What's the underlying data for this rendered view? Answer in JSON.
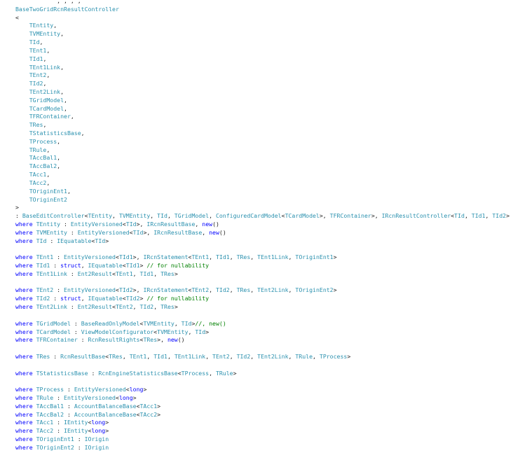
{
  "theme": {
    "keyword": "#0000ff",
    "type": "#2b91af",
    "plain": "#1e1e1e",
    "comment": "#008000",
    "background": "#ffffff"
  },
  "lines": [
    [
      [
        "plain",
        "            , , , ,"
      ]
    ],
    [
      [
        "type",
        "BaseTwoGridRcnResultController"
      ]
    ],
    [
      [
        "plain",
        "<"
      ]
    ],
    [
      [
        "plain",
        "    "
      ],
      [
        "type",
        "TEntity"
      ],
      [
        "plain",
        ","
      ]
    ],
    [
      [
        "plain",
        "    "
      ],
      [
        "type",
        "TVMEntity"
      ],
      [
        "plain",
        ","
      ]
    ],
    [
      [
        "plain",
        "    "
      ],
      [
        "type",
        "TId"
      ],
      [
        "plain",
        ","
      ]
    ],
    [
      [
        "plain",
        "    "
      ],
      [
        "type",
        "TEnt1"
      ],
      [
        "plain",
        ","
      ]
    ],
    [
      [
        "plain",
        "    "
      ],
      [
        "type",
        "TId1"
      ],
      [
        "plain",
        ","
      ]
    ],
    [
      [
        "plain",
        "    "
      ],
      [
        "type",
        "TEnt1Link"
      ],
      [
        "plain",
        ","
      ]
    ],
    [
      [
        "plain",
        "    "
      ],
      [
        "type",
        "TEnt2"
      ],
      [
        "plain",
        ","
      ]
    ],
    [
      [
        "plain",
        "    "
      ],
      [
        "type",
        "TId2"
      ],
      [
        "plain",
        ","
      ]
    ],
    [
      [
        "plain",
        "    "
      ],
      [
        "type",
        "TEnt2Link"
      ],
      [
        "plain",
        ","
      ]
    ],
    [
      [
        "plain",
        "    "
      ],
      [
        "type",
        "TGridModel"
      ],
      [
        "plain",
        ","
      ]
    ],
    [
      [
        "plain",
        "    "
      ],
      [
        "type",
        "TCardModel"
      ],
      [
        "plain",
        ","
      ]
    ],
    [
      [
        "plain",
        "    "
      ],
      [
        "type",
        "TFRContainer"
      ],
      [
        "plain",
        ","
      ]
    ],
    [
      [
        "plain",
        "    "
      ],
      [
        "type",
        "TRes"
      ],
      [
        "plain",
        ","
      ]
    ],
    [
      [
        "plain",
        "    "
      ],
      [
        "type",
        "TStatisticsBase"
      ],
      [
        "plain",
        ","
      ]
    ],
    [
      [
        "plain",
        "    "
      ],
      [
        "type",
        "TProcess"
      ],
      [
        "plain",
        ","
      ]
    ],
    [
      [
        "plain",
        "    "
      ],
      [
        "type",
        "TRule"
      ],
      [
        "plain",
        ","
      ]
    ],
    [
      [
        "plain",
        "    "
      ],
      [
        "type",
        "TAccBal1"
      ],
      [
        "plain",
        ","
      ]
    ],
    [
      [
        "plain",
        "    "
      ],
      [
        "type",
        "TAccBal2"
      ],
      [
        "plain",
        ","
      ]
    ],
    [
      [
        "plain",
        "    "
      ],
      [
        "type",
        "TAcc1"
      ],
      [
        "plain",
        ","
      ]
    ],
    [
      [
        "plain",
        "    "
      ],
      [
        "type",
        "TAcc2"
      ],
      [
        "plain",
        ","
      ]
    ],
    [
      [
        "plain",
        "    "
      ],
      [
        "type",
        "TOriginEnt1"
      ],
      [
        "plain",
        ","
      ]
    ],
    [
      [
        "plain",
        "    "
      ],
      [
        "type",
        "TOriginEnt2"
      ]
    ],
    [
      [
        "plain",
        ">"
      ]
    ],
    [
      [
        "plain",
        ": "
      ],
      [
        "type",
        "BaseEditController"
      ],
      [
        "plain",
        "<"
      ],
      [
        "type",
        "TEntity"
      ],
      [
        "plain",
        ", "
      ],
      [
        "type",
        "TVMEntity"
      ],
      [
        "plain",
        ", "
      ],
      [
        "type",
        "TId"
      ],
      [
        "plain",
        ", "
      ],
      [
        "type",
        "TGridModel"
      ],
      [
        "plain",
        ", "
      ],
      [
        "type",
        "ConfiguredCardModel"
      ],
      [
        "plain",
        "<"
      ],
      [
        "type",
        "TCardModel"
      ],
      [
        "plain",
        ">, "
      ],
      [
        "type",
        "TFRContainer"
      ],
      [
        "plain",
        ">, "
      ],
      [
        "type",
        "IRcnResultController"
      ],
      [
        "plain",
        "<"
      ],
      [
        "type",
        "TId"
      ],
      [
        "plain",
        ", "
      ],
      [
        "type",
        "TId1"
      ],
      [
        "plain",
        ", "
      ],
      [
        "type",
        "TId2"
      ],
      [
        "plain",
        ">"
      ]
    ],
    [
      [
        "kw",
        "where"
      ],
      [
        "plain",
        " "
      ],
      [
        "type",
        "TEntity"
      ],
      [
        "plain",
        " : "
      ],
      [
        "type",
        "EntityVersioned"
      ],
      [
        "plain",
        "<"
      ],
      [
        "type",
        "TId"
      ],
      [
        "plain",
        ">, "
      ],
      [
        "type",
        "IRcnResultBase"
      ],
      [
        "plain",
        ", "
      ],
      [
        "kw",
        "new"
      ],
      [
        "plain",
        "()"
      ]
    ],
    [
      [
        "kw",
        "where"
      ],
      [
        "plain",
        " "
      ],
      [
        "type",
        "TVMEntity"
      ],
      [
        "plain",
        " : "
      ],
      [
        "type",
        "EntityVersioned"
      ],
      [
        "plain",
        "<"
      ],
      [
        "type",
        "TId"
      ],
      [
        "plain",
        ">, "
      ],
      [
        "type",
        "IRcnResultBase"
      ],
      [
        "plain",
        ", "
      ],
      [
        "kw",
        "new"
      ],
      [
        "plain",
        "()"
      ]
    ],
    [
      [
        "kw",
        "where"
      ],
      [
        "plain",
        " "
      ],
      [
        "type",
        "TId"
      ],
      [
        "plain",
        " : "
      ],
      [
        "type",
        "IEquatable"
      ],
      [
        "plain",
        "<"
      ],
      [
        "type",
        "TId"
      ],
      [
        "plain",
        ">"
      ]
    ],
    [],
    [
      [
        "kw",
        "where"
      ],
      [
        "plain",
        " "
      ],
      [
        "type",
        "TEnt1"
      ],
      [
        "plain",
        " : "
      ],
      [
        "type",
        "EntityVersioned"
      ],
      [
        "plain",
        "<"
      ],
      [
        "type",
        "TId1"
      ],
      [
        "plain",
        ">, "
      ],
      [
        "type",
        "IRcnStatement"
      ],
      [
        "plain",
        "<"
      ],
      [
        "type",
        "TEnt1"
      ],
      [
        "plain",
        ", "
      ],
      [
        "type",
        "TId1"
      ],
      [
        "plain",
        ", "
      ],
      [
        "type",
        "TRes"
      ],
      [
        "plain",
        ", "
      ],
      [
        "type",
        "TEnt1Link"
      ],
      [
        "plain",
        ", "
      ],
      [
        "type",
        "TOriginEnt1"
      ],
      [
        "plain",
        ">"
      ]
    ],
    [
      [
        "kw",
        "where"
      ],
      [
        "plain",
        " "
      ],
      [
        "type",
        "TId1"
      ],
      [
        "plain",
        " : "
      ],
      [
        "kw",
        "struct"
      ],
      [
        "plain",
        ", "
      ],
      [
        "type",
        "IEquatable"
      ],
      [
        "plain",
        "<"
      ],
      [
        "type",
        "TId1"
      ],
      [
        "plain",
        "> "
      ],
      [
        "comment",
        "// for nullability"
      ]
    ],
    [
      [
        "kw",
        "where"
      ],
      [
        "plain",
        " "
      ],
      [
        "type",
        "TEnt1Link"
      ],
      [
        "plain",
        " : "
      ],
      [
        "type",
        "Ent2Result"
      ],
      [
        "plain",
        "<"
      ],
      [
        "type",
        "TEnt1"
      ],
      [
        "plain",
        ", "
      ],
      [
        "type",
        "TId1"
      ],
      [
        "plain",
        ", "
      ],
      [
        "type",
        "TRes"
      ],
      [
        "plain",
        ">"
      ]
    ],
    [],
    [
      [
        "kw",
        "where"
      ],
      [
        "plain",
        " "
      ],
      [
        "type",
        "TEnt2"
      ],
      [
        "plain",
        " : "
      ],
      [
        "type",
        "EntityVersioned"
      ],
      [
        "plain",
        "<"
      ],
      [
        "type",
        "TId2"
      ],
      [
        "plain",
        ">, "
      ],
      [
        "type",
        "IRcnStatement"
      ],
      [
        "plain",
        "<"
      ],
      [
        "type",
        "TEnt2"
      ],
      [
        "plain",
        ", "
      ],
      [
        "type",
        "TId2"
      ],
      [
        "plain",
        ", "
      ],
      [
        "type",
        "TRes"
      ],
      [
        "plain",
        ", "
      ],
      [
        "type",
        "TEnt2Link"
      ],
      [
        "plain",
        ", "
      ],
      [
        "type",
        "TOriginEnt2"
      ],
      [
        "plain",
        ">"
      ]
    ],
    [
      [
        "kw",
        "where"
      ],
      [
        "plain",
        " "
      ],
      [
        "type",
        "TId2"
      ],
      [
        "plain",
        " : "
      ],
      [
        "kw",
        "struct"
      ],
      [
        "plain",
        ", "
      ],
      [
        "type",
        "IEquatable"
      ],
      [
        "plain",
        "<"
      ],
      [
        "type",
        "TId2"
      ],
      [
        "plain",
        "> "
      ],
      [
        "comment",
        "// for nullability"
      ]
    ],
    [
      [
        "kw",
        "where"
      ],
      [
        "plain",
        " "
      ],
      [
        "type",
        "TEnt2Link"
      ],
      [
        "plain",
        " : "
      ],
      [
        "type",
        "Ent2Result"
      ],
      [
        "plain",
        "<"
      ],
      [
        "type",
        "TEnt2"
      ],
      [
        "plain",
        ", "
      ],
      [
        "type",
        "TId2"
      ],
      [
        "plain",
        ", "
      ],
      [
        "type",
        "TRes"
      ],
      [
        "plain",
        ">"
      ]
    ],
    [],
    [
      [
        "kw",
        "where"
      ],
      [
        "plain",
        " "
      ],
      [
        "type",
        "TGridModel"
      ],
      [
        "plain",
        " : "
      ],
      [
        "type",
        "BaseReadOnlyModel"
      ],
      [
        "plain",
        "<"
      ],
      [
        "type",
        "TVMEntity"
      ],
      [
        "plain",
        ", "
      ],
      [
        "type",
        "TId"
      ],
      [
        "plain",
        ">"
      ],
      [
        "comment",
        "//, new()"
      ]
    ],
    [
      [
        "kw",
        "where"
      ],
      [
        "plain",
        " "
      ],
      [
        "type",
        "TCardModel"
      ],
      [
        "plain",
        " : "
      ],
      [
        "type",
        "ViewModelConfigurator"
      ],
      [
        "plain",
        "<"
      ],
      [
        "type",
        "TVMEntity"
      ],
      [
        "plain",
        ", "
      ],
      [
        "type",
        "TId"
      ],
      [
        "plain",
        ">"
      ]
    ],
    [
      [
        "kw",
        "where"
      ],
      [
        "plain",
        " "
      ],
      [
        "type",
        "TFRContainer"
      ],
      [
        "plain",
        " : "
      ],
      [
        "type",
        "RcnResultRights"
      ],
      [
        "plain",
        "<"
      ],
      [
        "type",
        "TRes"
      ],
      [
        "plain",
        ">, "
      ],
      [
        "kw",
        "new"
      ],
      [
        "plain",
        "()"
      ]
    ],
    [],
    [
      [
        "kw",
        "where"
      ],
      [
        "plain",
        " "
      ],
      [
        "type",
        "TRes"
      ],
      [
        "plain",
        " : "
      ],
      [
        "type",
        "RcnResultBase"
      ],
      [
        "plain",
        "<"
      ],
      [
        "type",
        "TRes"
      ],
      [
        "plain",
        ", "
      ],
      [
        "type",
        "TEnt1"
      ],
      [
        "plain",
        ", "
      ],
      [
        "type",
        "TId1"
      ],
      [
        "plain",
        ", "
      ],
      [
        "type",
        "TEnt1Link"
      ],
      [
        "plain",
        ", "
      ],
      [
        "type",
        "TEnt2"
      ],
      [
        "plain",
        ", "
      ],
      [
        "type",
        "TId2"
      ],
      [
        "plain",
        ", "
      ],
      [
        "type",
        "TEnt2Link"
      ],
      [
        "plain",
        ", "
      ],
      [
        "type",
        "TRule"
      ],
      [
        "plain",
        ", "
      ],
      [
        "type",
        "TProcess"
      ],
      [
        "plain",
        ">"
      ]
    ],
    [],
    [
      [
        "kw",
        "where"
      ],
      [
        "plain",
        " "
      ],
      [
        "type",
        "TStatisticsBase"
      ],
      [
        "plain",
        " : "
      ],
      [
        "type",
        "RcnEngineStatisticsBase"
      ],
      [
        "plain",
        "<"
      ],
      [
        "type",
        "TProcess"
      ],
      [
        "plain",
        ", "
      ],
      [
        "type",
        "TRule"
      ],
      [
        "plain",
        ">"
      ]
    ],
    [],
    [
      [
        "kw",
        "where"
      ],
      [
        "plain",
        " "
      ],
      [
        "type",
        "TProcess"
      ],
      [
        "plain",
        " : "
      ],
      [
        "type",
        "EntityVersioned"
      ],
      [
        "plain",
        "<"
      ],
      [
        "kw",
        "long"
      ],
      [
        "plain",
        ">"
      ]
    ],
    [
      [
        "kw",
        "where"
      ],
      [
        "plain",
        " "
      ],
      [
        "type",
        "TRule"
      ],
      [
        "plain",
        " : "
      ],
      [
        "type",
        "EntityVersioned"
      ],
      [
        "plain",
        "<"
      ],
      [
        "kw",
        "long"
      ],
      [
        "plain",
        ">"
      ]
    ],
    [
      [
        "kw",
        "where"
      ],
      [
        "plain",
        " "
      ],
      [
        "type",
        "TAccBal1"
      ],
      [
        "plain",
        " : "
      ],
      [
        "type",
        "AccountBalanceBase"
      ],
      [
        "plain",
        "<"
      ],
      [
        "type",
        "TAcc1"
      ],
      [
        "plain",
        ">"
      ]
    ],
    [
      [
        "kw",
        "where"
      ],
      [
        "plain",
        " "
      ],
      [
        "type",
        "TAccBal2"
      ],
      [
        "plain",
        " : "
      ],
      [
        "type",
        "AccountBalanceBase"
      ],
      [
        "plain",
        "<"
      ],
      [
        "type",
        "TAcc2"
      ],
      [
        "plain",
        ">"
      ]
    ],
    [
      [
        "kw",
        "where"
      ],
      [
        "plain",
        " "
      ],
      [
        "type",
        "TAcc1"
      ],
      [
        "plain",
        " : "
      ],
      [
        "type",
        "IEntity"
      ],
      [
        "plain",
        "<"
      ],
      [
        "kw",
        "long"
      ],
      [
        "plain",
        ">"
      ]
    ],
    [
      [
        "kw",
        "where"
      ],
      [
        "plain",
        " "
      ],
      [
        "type",
        "TAcc2"
      ],
      [
        "plain",
        " : "
      ],
      [
        "type",
        "IEntity"
      ],
      [
        "plain",
        "<"
      ],
      [
        "kw",
        "long"
      ],
      [
        "plain",
        ">"
      ]
    ],
    [
      [
        "kw",
        "where"
      ],
      [
        "plain",
        " "
      ],
      [
        "type",
        "TOriginEnt1"
      ],
      [
        "plain",
        " : "
      ],
      [
        "type",
        "IOrigin"
      ]
    ],
    [
      [
        "kw",
        "where"
      ],
      [
        "plain",
        " "
      ],
      [
        "type",
        "TOriginEnt2"
      ],
      [
        "plain",
        " : "
      ],
      [
        "type",
        "IOrigin"
      ]
    ]
  ]
}
